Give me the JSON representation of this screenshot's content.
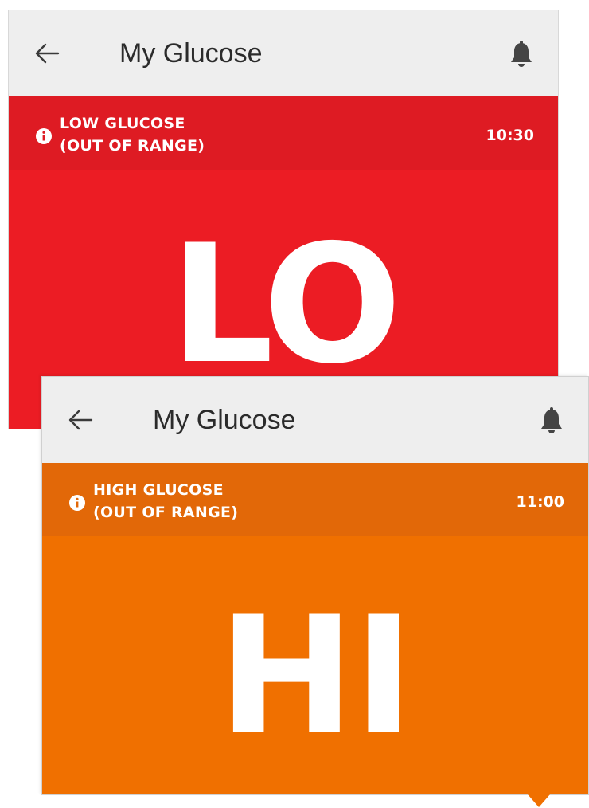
{
  "screens": [
    {
      "id": "low",
      "title": "My Glucose",
      "back_icon": "arrow-left-icon",
      "alarm_icon": "bell-icon",
      "status_line1": "LOW GLUCOSE",
      "status_line2": "(OUT OF RANGE)",
      "time": "10:30",
      "reading": "LO",
      "colors": {
        "bar": "#de1b23",
        "body": "#ec1c24"
      }
    },
    {
      "id": "high",
      "title": "My Glucose",
      "back_icon": "arrow-left-icon",
      "alarm_icon": "bell-icon",
      "status_line1": "HIGH GLUCOSE",
      "status_line2": "(OUT OF RANGE)",
      "time": "11:00",
      "reading": "HI",
      "colors": {
        "bar": "#e26808",
        "body": "#f07000"
      }
    }
  ]
}
